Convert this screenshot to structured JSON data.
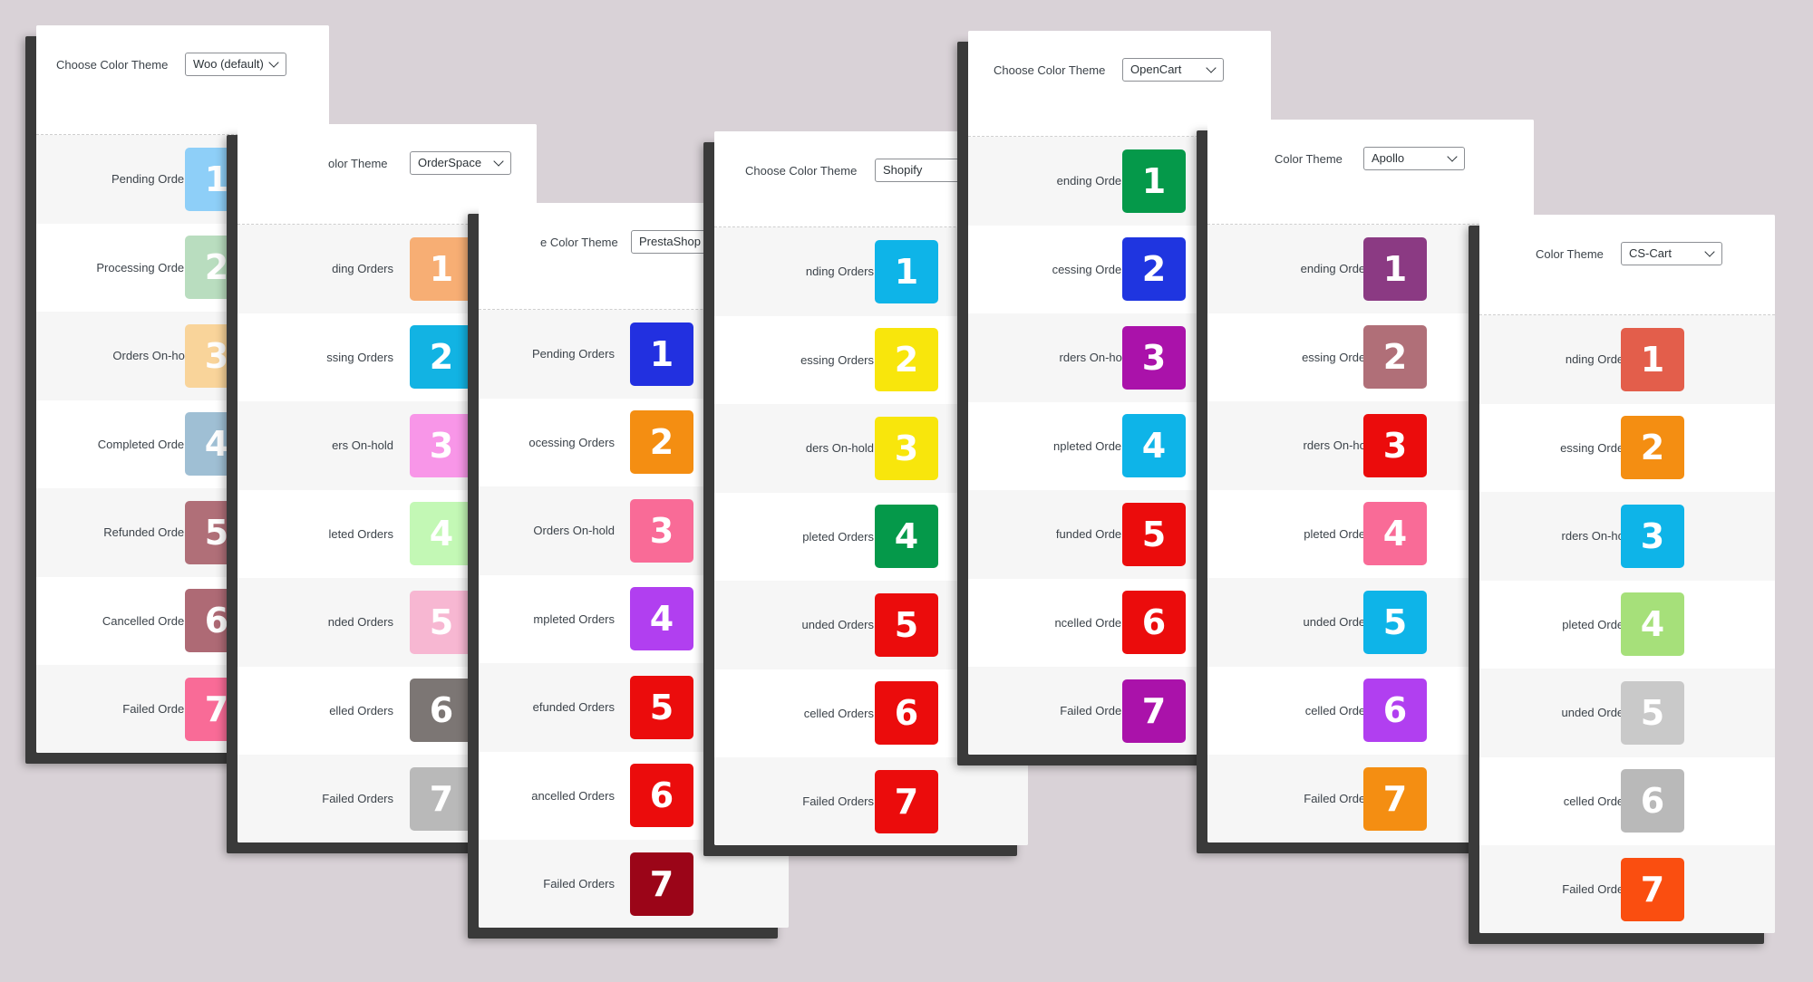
{
  "colors": {
    "background": "#d9d2d7",
    "shadow": "#3a3a3a"
  },
  "panels": [
    {
      "label": "Choose Color Theme",
      "theme": "Woo (default)",
      "rows": [
        {
          "label": "Pending Orders",
          "num": "1",
          "color": "#8ecff8"
        },
        {
          "label": "Processing Orders",
          "num": "2",
          "color": "#b9ddbf"
        },
        {
          "label": "Orders On-hold",
          "num": "3",
          "color": "#f9d49a"
        },
        {
          "label": "Completed Orders",
          "num": "4",
          "color": "#9fbfd4"
        },
        {
          "label": "Refunded Orders",
          "num": "5",
          "color": "#b06f78"
        },
        {
          "label": "Cancelled Orders",
          "num": "6",
          "color": "#ae6a75"
        },
        {
          "label": "Failed Orders",
          "num": "7",
          "color": "#f96b97"
        }
      ]
    },
    {
      "label": "olor Theme",
      "theme": "OrderSpace",
      "rows": [
        {
          "label": "ding Orders",
          "num": "1",
          "color": "#f7ae74"
        },
        {
          "label": "ssing Orders",
          "num": "2",
          "color": "#12b3e3"
        },
        {
          "label": "ers On-hold",
          "num": "3",
          "color": "#f896e8"
        },
        {
          "label": "leted Orders",
          "num": "4",
          "color": "#c3f8b5"
        },
        {
          "label": "nded Orders",
          "num": "5",
          "color": "#f7b7d2"
        },
        {
          "label": "elled Orders",
          "num": "6",
          "color": "#7c7674"
        },
        {
          "label": "Failed Orders",
          "num": "7",
          "color": "#b9b9b9"
        }
      ]
    },
    {
      "label": "e Color Theme",
      "theme": "PrestaShop",
      "rows": [
        {
          "label": "Pending Orders",
          "num": "1",
          "color": "#2230e0"
        },
        {
          "label": "ocessing Orders",
          "num": "2",
          "color": "#f48e12"
        },
        {
          "label": "Orders On-hold",
          "num": "3",
          "color": "#f96b97"
        },
        {
          "label": "mpleted Orders",
          "num": "4",
          "color": "#b13ff0"
        },
        {
          "label": "efunded Orders",
          "num": "5",
          "color": "#eb0c0c"
        },
        {
          "label": "ancelled Orders",
          "num": "6",
          "color": "#eb0c0c"
        },
        {
          "label": "Failed Orders",
          "num": "7",
          "color": "#9b0518"
        }
      ]
    },
    {
      "label": "Choose Color Theme",
      "theme": "Shopify",
      "rows": [
        {
          "label": "nding Orders",
          "num": "1",
          "color": "#0eb4e8"
        },
        {
          "label": "essing Orders",
          "num": "2",
          "color": "#f8e60c"
        },
        {
          "label": "ders On-hold",
          "num": "3",
          "color": "#f8e60c"
        },
        {
          "label": "pleted Orders",
          "num": "4",
          "color": "#05994a"
        },
        {
          "label": "unded Orders",
          "num": "5",
          "color": "#eb0c0c"
        },
        {
          "label": "celled Orders",
          "num": "6",
          "color": "#eb0c0c"
        },
        {
          "label": "Failed Orders",
          "num": "7",
          "color": "#eb0c0c"
        }
      ]
    },
    {
      "label": "Choose Color Theme",
      "theme": "OpenCart",
      "rows": [
        {
          "label": "ending Orders",
          "num": "1",
          "color": "#05994a"
        },
        {
          "label": "cessing Orders",
          "num": "2",
          "color": "#1f35e0"
        },
        {
          "label": "rders On-hold",
          "num": "3",
          "color": "#aa12aa"
        },
        {
          "label": "npleted Orders",
          "num": "4",
          "color": "#0eb4e8"
        },
        {
          "label": "funded Orders",
          "num": "5",
          "color": "#eb0c0c"
        },
        {
          "label": "ncelled Orders",
          "num": "6",
          "color": "#eb0c0c"
        },
        {
          "label": "Failed Orders",
          "num": "7",
          "color": "#aa12aa"
        }
      ]
    },
    {
      "label": "Color Theme",
      "theme": "Apollo",
      "rows": [
        {
          "label": "ending Orders",
          "num": "1",
          "color": "#8b3a83"
        },
        {
          "label": "essing Orders",
          "num": "2",
          "color": "#b06f78"
        },
        {
          "label": "rders On-hold",
          "num": "3",
          "color": "#eb0c0c"
        },
        {
          "label": "pleted Orders",
          "num": "4",
          "color": "#f96b97"
        },
        {
          "label": "unded Orders",
          "num": "5",
          "color": "#0eb4e8"
        },
        {
          "label": "celled Orders",
          "num": "6",
          "color": "#b13ff0"
        },
        {
          "label": "Failed Orders",
          "num": "7",
          "color": "#f48e12"
        }
      ]
    },
    {
      "label": "Color Theme",
      "theme": "CS-Cart",
      "rows": [
        {
          "label": "nding Orders",
          "num": "1",
          "color": "#e35e4b"
        },
        {
          "label": "essing Orders",
          "num": "2",
          "color": "#f48e12"
        },
        {
          "label": "rders On-hold",
          "num": "3",
          "color": "#0eb4e8"
        },
        {
          "label": "pleted Orders",
          "num": "4",
          "color": "#a6e07a"
        },
        {
          "label": "unded Orders",
          "num": "5",
          "color": "#c9c9c9"
        },
        {
          "label": "celled Orders",
          "num": "6",
          "color": "#b9b9b9"
        },
        {
          "label": "Failed Orders",
          "num": "7",
          "color": "#fa4e10"
        }
      ]
    }
  ]
}
